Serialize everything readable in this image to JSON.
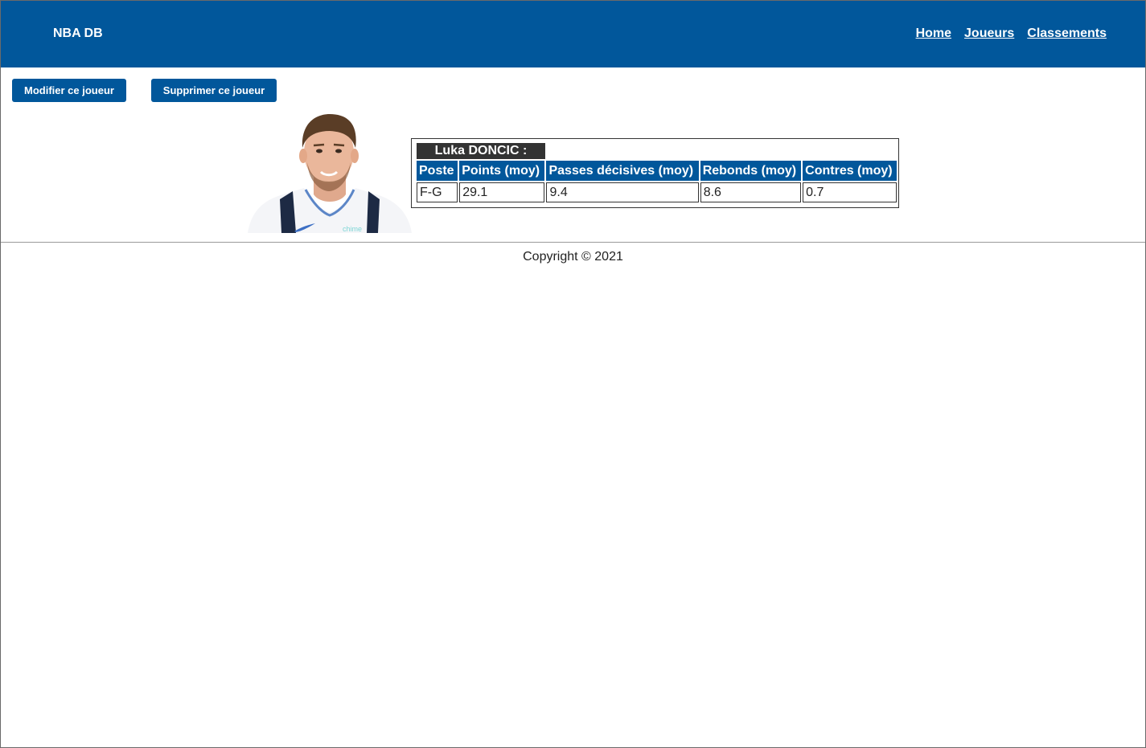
{
  "header": {
    "brand": "NBA DB",
    "nav": [
      {
        "label": "Home"
      },
      {
        "label": "Joueurs"
      },
      {
        "label": "Classements"
      }
    ]
  },
  "actions": {
    "edit_label": "Modifier ce joueur",
    "delete_label": "Supprimer ce joueur"
  },
  "player": {
    "name": "Luka DONCIC :",
    "photo_icon": "player-photo",
    "columns": [
      "Poste",
      "Points (moy)",
      "Passes décisives (moy)",
      "Rebonds (moy)",
      "Contres (moy)"
    ],
    "values": [
      "F-G",
      "29.1",
      "9.4",
      "8.6",
      "0.7"
    ]
  },
  "footer": {
    "copyright": "Copyright © 2021"
  },
  "colors": {
    "primary": "#01579b",
    "name_bg": "#333333"
  }
}
